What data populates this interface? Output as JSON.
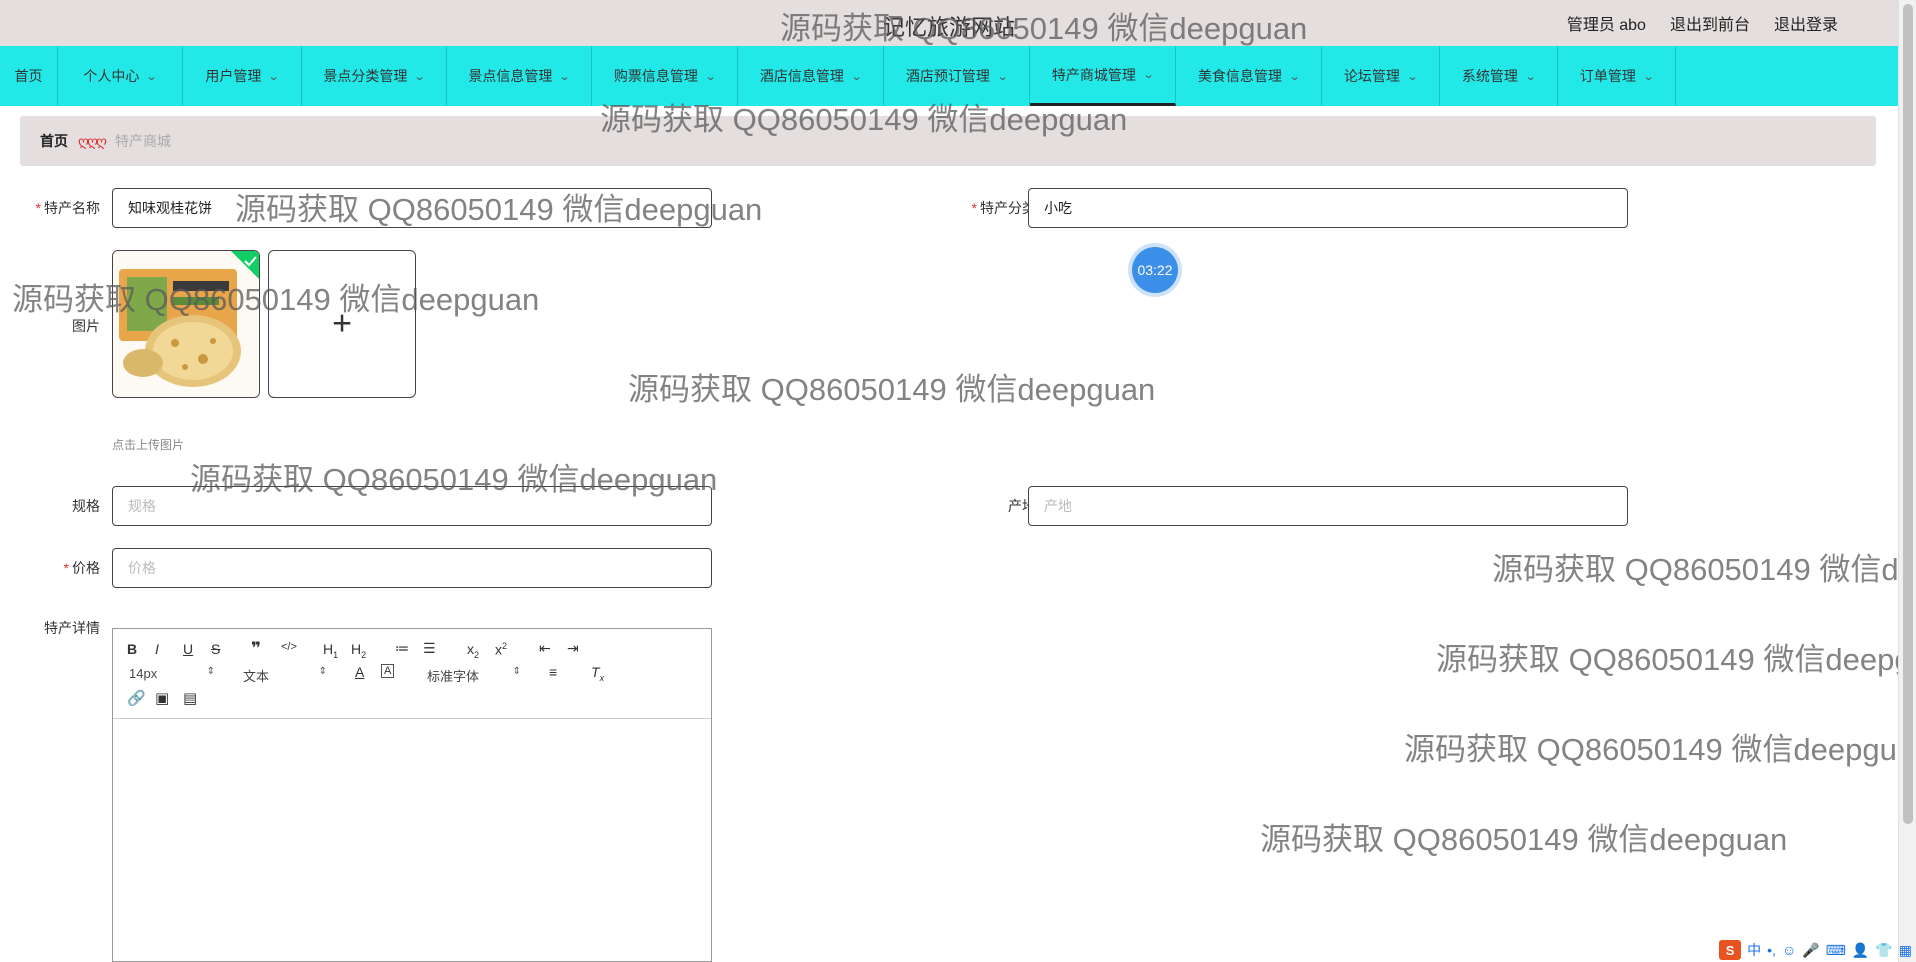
{
  "header": {
    "site_title": "记忆旅游网站",
    "user_label": "管理员 abo",
    "front_label": "退出到前台",
    "logout_label": "退出登录"
  },
  "nav": {
    "items": [
      {
        "label": "首页",
        "has_chevron": false
      },
      {
        "label": "个人中心",
        "has_chevron": true
      },
      {
        "label": "用户管理",
        "has_chevron": true
      },
      {
        "label": "景点分类管理",
        "has_chevron": true
      },
      {
        "label": "景点信息管理",
        "has_chevron": true
      },
      {
        "label": "购票信息管理",
        "has_chevron": true
      },
      {
        "label": "酒店信息管理",
        "has_chevron": true
      },
      {
        "label": "酒店预订管理",
        "has_chevron": true
      },
      {
        "label": "特产商城管理",
        "has_chevron": true
      },
      {
        "label": "美食信息管理",
        "has_chevron": true
      },
      {
        "label": "论坛管理",
        "has_chevron": true
      },
      {
        "label": "系统管理",
        "has_chevron": true
      },
      {
        "label": "订单管理",
        "has_chevron": true
      }
    ],
    "active_index": 8
  },
  "breadcrumb": {
    "home": "首页",
    "separator": "ღღღ",
    "current": "特产商城"
  },
  "form": {
    "name_label": "特产名称",
    "name_value": "知味观桂花饼",
    "category_label": "特产分类",
    "category_value": "小吃",
    "image_label": "图片",
    "upload_hint": "点击上传图片",
    "spec_label": "规格",
    "spec_placeholder": "规格",
    "origin_label": "产地",
    "origin_placeholder": "产地",
    "price_label": "价格",
    "price_placeholder": "价格",
    "detail_label": "特产详情",
    "required_mark": "*"
  },
  "editor": {
    "font_size": "14px",
    "block_type": "文本",
    "font_family": "标准字体"
  },
  "timer_badge": "03:22",
  "watermark_text": "源码获取 QQ86050149 微信deepguan",
  "ime": {
    "mode": "中",
    "punct": "•,"
  },
  "colors": {
    "nav_bg": "#22e8e8",
    "header_bg": "#e4dede",
    "required": "#e03030",
    "badge": "#3c8fe8"
  }
}
